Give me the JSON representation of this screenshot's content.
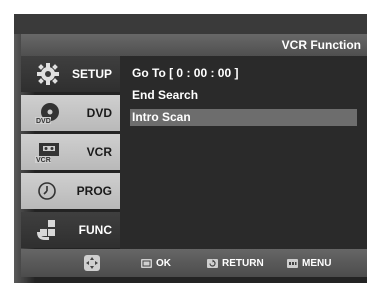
{
  "header": {
    "title": "VCR Function"
  },
  "sidebar": {
    "items": [
      {
        "label": "SETUP",
        "icon": "gear-icon",
        "active": true
      },
      {
        "label": "DVD",
        "icon": "dvd-disc-icon",
        "active": false
      },
      {
        "label": "VCR",
        "icon": "vcr-cassette-icon",
        "active": false
      },
      {
        "label": "PROG",
        "icon": "clock-icon",
        "active": false
      },
      {
        "label": "FUNC",
        "icon": "function-grid-icon",
        "active": true
      }
    ]
  },
  "content": {
    "items": [
      {
        "label": "Go To [ 0 : 00 : 00 ]"
      },
      {
        "label": "End Search"
      },
      {
        "label": "Intro Scan",
        "selected": true
      }
    ]
  },
  "bottombar": {
    "nav_icon": "directional-pad-icon",
    "ok_label": "OK",
    "return_label": "RETURN",
    "menu_label": "MENU"
  }
}
